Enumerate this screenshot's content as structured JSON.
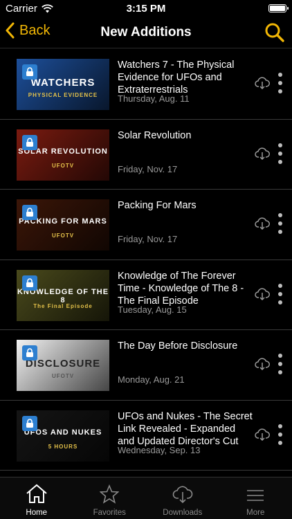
{
  "status": {
    "carrier": "Carrier",
    "time": "3:15 PM",
    "battery_level": 1.0
  },
  "nav": {
    "back_label": "Back",
    "title": "New Additions"
  },
  "items": [
    {
      "title": "Watchers 7 - The Physical Evidence for UFOs and Extraterrestrials",
      "date": "Thursday, Aug. 11",
      "thumb_text": "WATCHERS",
      "thumb_sub": "PHYSICAL EVIDENCE",
      "thumb_color": "#1d4f9a"
    },
    {
      "title": "Solar Revolution",
      "date": "Friday, Nov. 17",
      "thumb_text": "SOLAR REVOLUTION",
      "thumb_sub": "UFOTV",
      "thumb_color": "#7a1b10"
    },
    {
      "title": "Packing For Mars",
      "date": "Friday, Nov. 17",
      "thumb_text": "PACKING FOR MARS",
      "thumb_sub": "UFOTV",
      "thumb_color": "#3b1608"
    },
    {
      "title": "Knowledge of The Forever Time - Knowledge of The 8 - The Final Episode",
      "date": "Tuesday, Aug. 15",
      "thumb_text": "KNOWLEDGE OF THE 8",
      "thumb_sub": "The Final Episode",
      "thumb_color": "#4a4a1c"
    },
    {
      "title": "The Day Before Disclosure",
      "date": "Monday, Aug. 21",
      "thumb_text": "DISCLOSURE",
      "thumb_sub": "UFOTV",
      "thumb_color": "#f2f2f2"
    },
    {
      "title": "UFOs and Nukes - The Secret Link Revealed - Expanded and Updated Director's Cut",
      "date": "Wednesday, Sep. 13",
      "thumb_text": "UFOS AND NUKES",
      "thumb_sub": "5 HOURS",
      "thumb_color": "#151515"
    }
  ],
  "tabs": [
    {
      "label": "Home",
      "icon": "house-icon",
      "active": true
    },
    {
      "label": "Favorites",
      "icon": "star-icon",
      "active": false
    },
    {
      "label": "Downloads",
      "icon": "cloud-download-icon",
      "active": false
    },
    {
      "label": "More",
      "icon": "menu-icon",
      "active": false
    }
  ],
  "colors": {
    "accent": "#f2b705",
    "lock": "#2d7fd0",
    "subtext": "#9a9a9a"
  }
}
